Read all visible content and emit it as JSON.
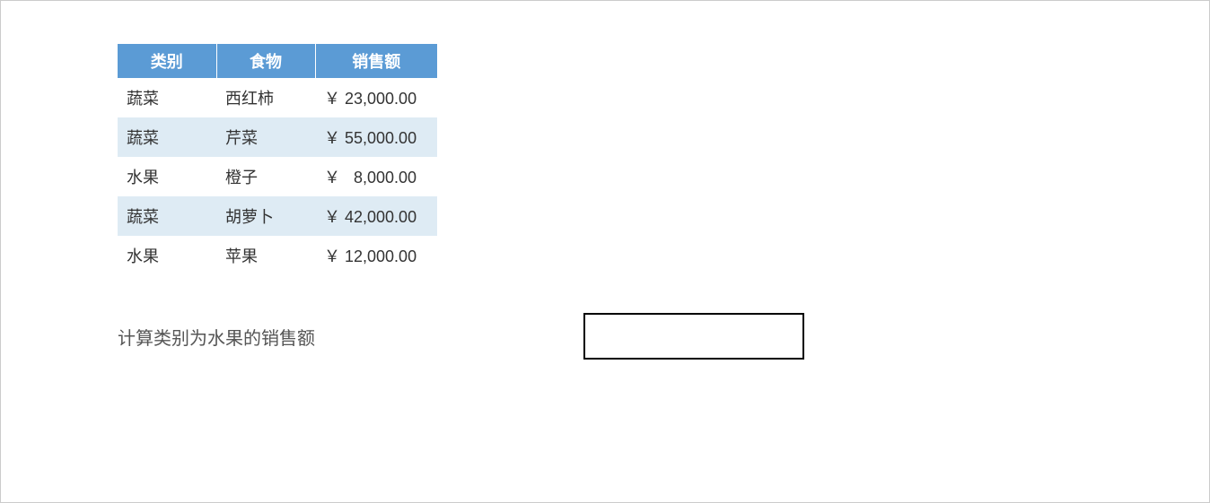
{
  "table": {
    "headers": {
      "category": "类别",
      "food": "食物",
      "sales": "销售额"
    },
    "rows": [
      {
        "category": "蔬菜",
        "food": "西红柿",
        "sales": "￥ 23,000.00"
      },
      {
        "category": "蔬菜",
        "food": "芹菜",
        "sales": "￥ 55,000.00"
      },
      {
        "category": "水果",
        "food": "橙子",
        "sales": "￥   8,000.00"
      },
      {
        "category": "蔬菜",
        "food": "胡萝卜",
        "sales": "￥ 42,000.00"
      },
      {
        "category": "水果",
        "food": "苹果",
        "sales": "￥ 12,000.00"
      }
    ]
  },
  "prompt": {
    "label": "计算类别为水果的销售额",
    "answer_value": ""
  }
}
